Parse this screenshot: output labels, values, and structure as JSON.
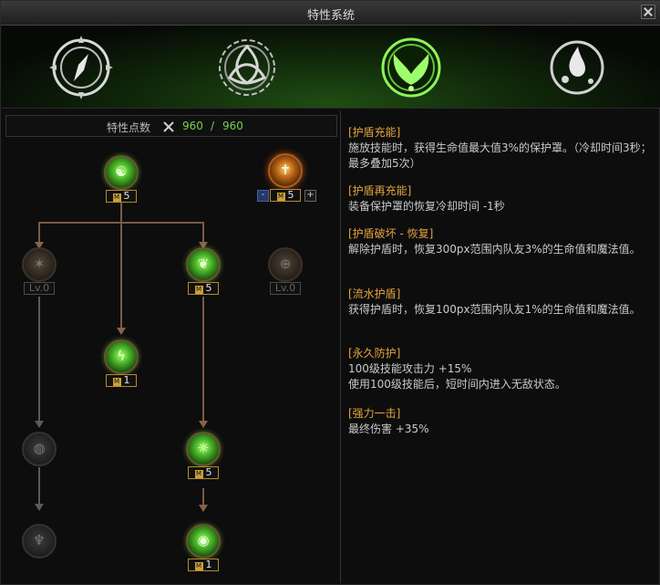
{
  "window": {
    "title": "特性系统"
  },
  "banner": {
    "emblems": [
      {
        "icon": "compass-emblem-icon",
        "active": false
      },
      {
        "icon": "triquetra-emblem-icon",
        "active": false
      },
      {
        "icon": "wings-emblem-icon",
        "active": true
      },
      {
        "icon": "water-drop-emblem-icon",
        "active": false
      }
    ]
  },
  "points": {
    "label": "特性点数",
    "icon": "crossed-swords-icon",
    "current": "960",
    "separator": "/",
    "max": "960"
  },
  "tree": {
    "nodes": [
      {
        "id": "n1",
        "state": "active",
        "glyph": "☯",
        "level_prefix": "M",
        "level": "5"
      },
      {
        "id": "n2",
        "state": "special",
        "glyph": "✝",
        "level_prefix": "M",
        "level": "5",
        "minus": "-",
        "plus": "+"
      },
      {
        "id": "n3",
        "state": "inactive",
        "glyph": "✶",
        "level_prefix": "Lv.",
        "level": "0"
      },
      {
        "id": "n4",
        "state": "active",
        "glyph": "❦",
        "level_prefix": "M",
        "level": "5"
      },
      {
        "id": "n5",
        "state": "inactive",
        "glyph": "⊕",
        "level_prefix": "Lv.",
        "level": "0"
      },
      {
        "id": "n6",
        "state": "active",
        "glyph": "ϟ",
        "level_prefix": "M",
        "level": "1"
      },
      {
        "id": "n7",
        "state": "locked",
        "glyph": "◍",
        "level_prefix": "",
        "level": ""
      },
      {
        "id": "n8",
        "state": "active",
        "glyph": "☼",
        "level_prefix": "M",
        "level": "5"
      },
      {
        "id": "n9",
        "state": "locked",
        "glyph": "♆",
        "level_prefix": "",
        "level": ""
      },
      {
        "id": "n10",
        "state": "active",
        "glyph": "◉",
        "level_prefix": "M",
        "level": "1"
      }
    ]
  },
  "details": [
    {
      "head": "[护盾充能]",
      "body": "施放技能时，获得生命值最大值3%的保护罩。（冷却时间3秒；最多叠加5次）"
    },
    {
      "head": "[护盾再充能]",
      "body": "装备保护罩的恢复冷却时间 -1秒"
    },
    {
      "head": "[护盾破坏 - 恢复]",
      "body": "解除护盾时，恢复300px范围内队友3%的生命值和魔法值。"
    },
    {
      "head": "[流水护盾]",
      "body": "获得护盾时，恢复100px范围内队友1%的生命值和魔法值。"
    },
    {
      "head": "[永久防护]",
      "body": "100级技能攻击力 +15%\n使用100级技能后，短时间内进入无敌状态。"
    },
    {
      "head": "[强力一击]",
      "body": "最终伤害 +35%"
    }
  ]
}
